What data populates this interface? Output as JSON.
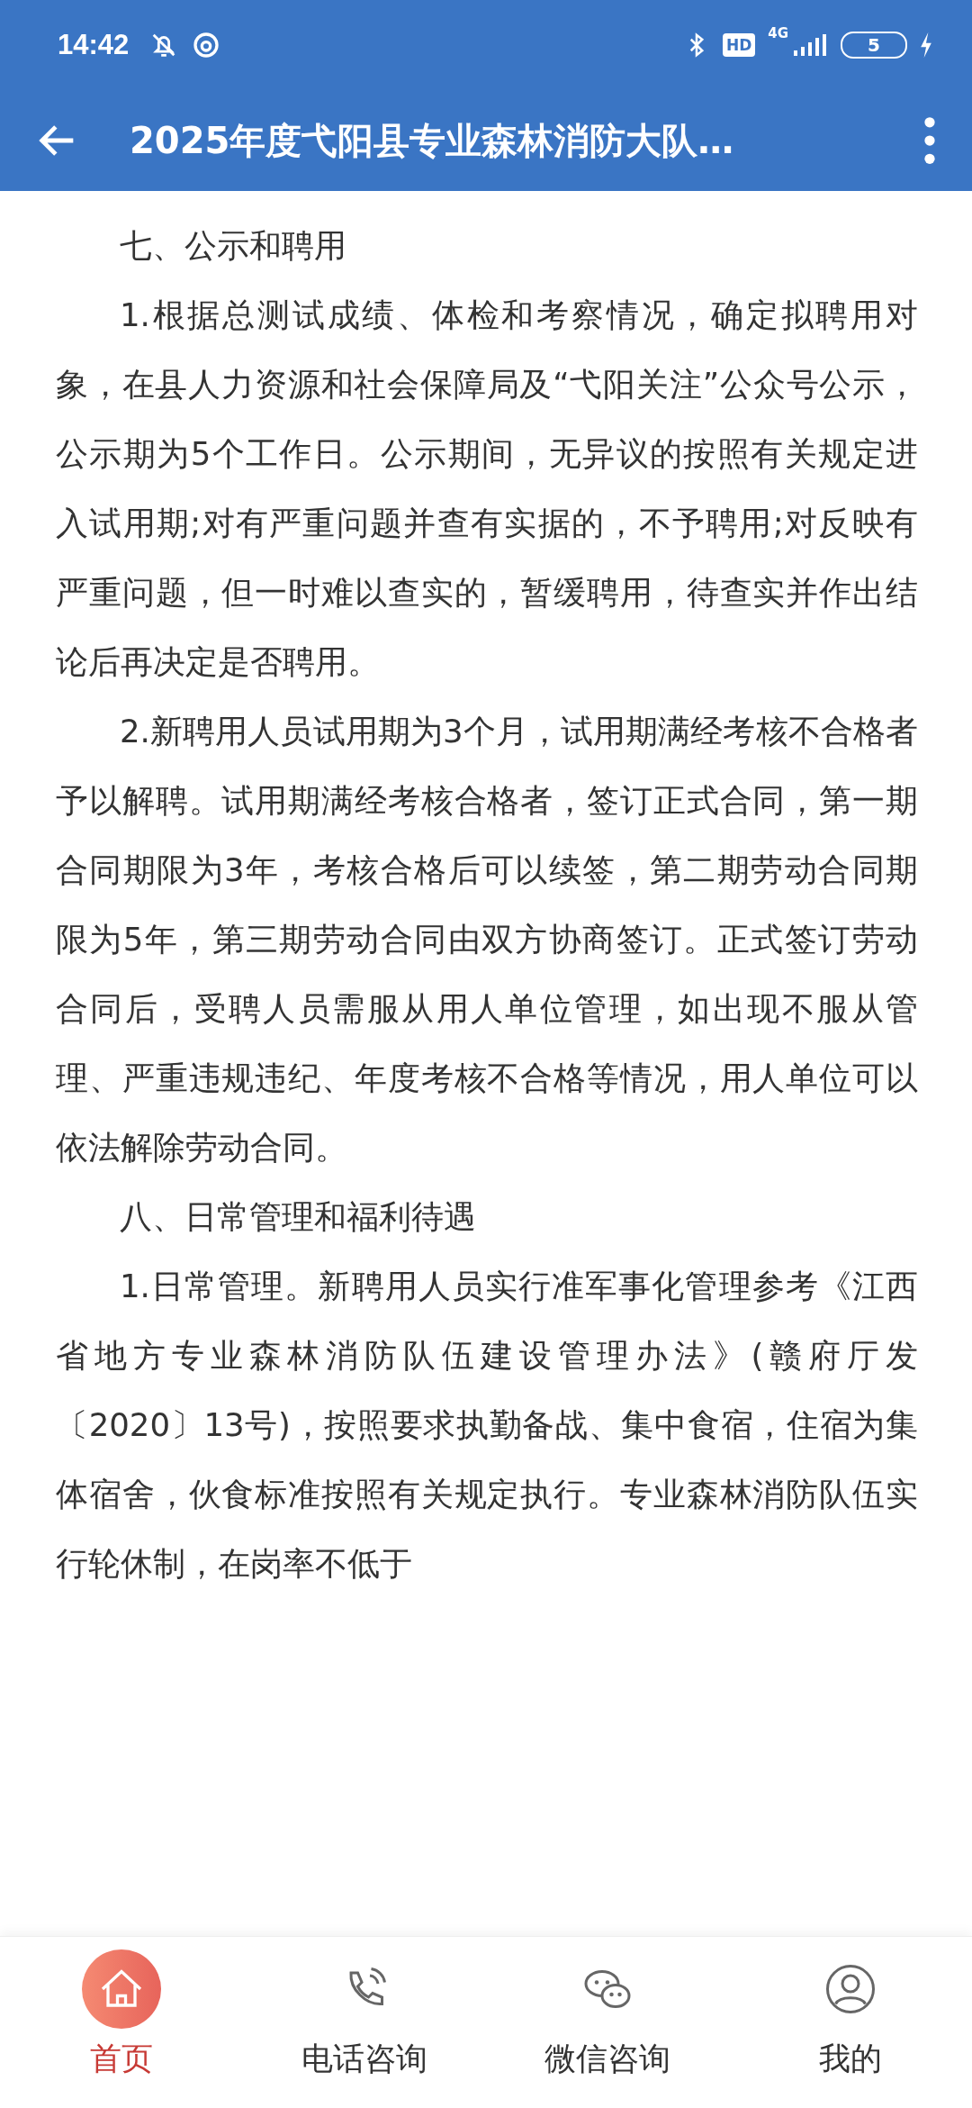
{
  "status_bar": {
    "time": "14:42",
    "hd": "HD",
    "network": "4G",
    "battery": "5"
  },
  "app_bar": {
    "title": "2025年度弋阳县专业森林消防大队…"
  },
  "article": {
    "paragraphs": [
      "七、公示和聘用",
      "1.根据总测试成绩、体检和考察情况，确定拟聘用对象，在县人力资源和社会保障局及“弋阳关注”公众号公示，公示期为5个工作日。公示期间，无异议的按照有关规定进入试用期;对有严重问题并查有实据的，不予聘用;对反映有严重问题，但一时难以查实的，暂缓聘用，待查实并作出结论后再决定是否聘用。",
      "2.新聘用人员试用期为3个月，试用期满经考核不合格者予以解聘。试用期满经考核合格者，签订正式合同，第一期合同期限为3年，考核合格后可以续签，第二期劳动合同期限为5年，第三期劳动合同由双方协商签订。正式签订劳动合同后，受聘人员需服从用人单位管理，如出现不服从管理、严重违规违纪、年度考核不合格等情况，用人单位可以依法解除劳动合同。",
      "八、日常管理和福利待遇",
      "1.日常管理。新聘用人员实行准军事化管理参考《江西省地方专业森林消防队伍建设管理办法》(赣府厅发〔2020〕13号)，按照要求执勤备战、集中食宿，住宿为集体宿舍，伙食标准按照有关规定执行。专业森林消防队伍实行轮休制，在岗率不低于"
    ]
  },
  "bottom_nav": [
    {
      "kind": "home",
      "label": "首页",
      "selected": true
    },
    {
      "kind": "phone",
      "label": "电话咨询",
      "selected": false
    },
    {
      "kind": "chat",
      "label": "微信咨询",
      "selected": false
    },
    {
      "kind": "user",
      "label": "我的",
      "selected": false
    }
  ]
}
